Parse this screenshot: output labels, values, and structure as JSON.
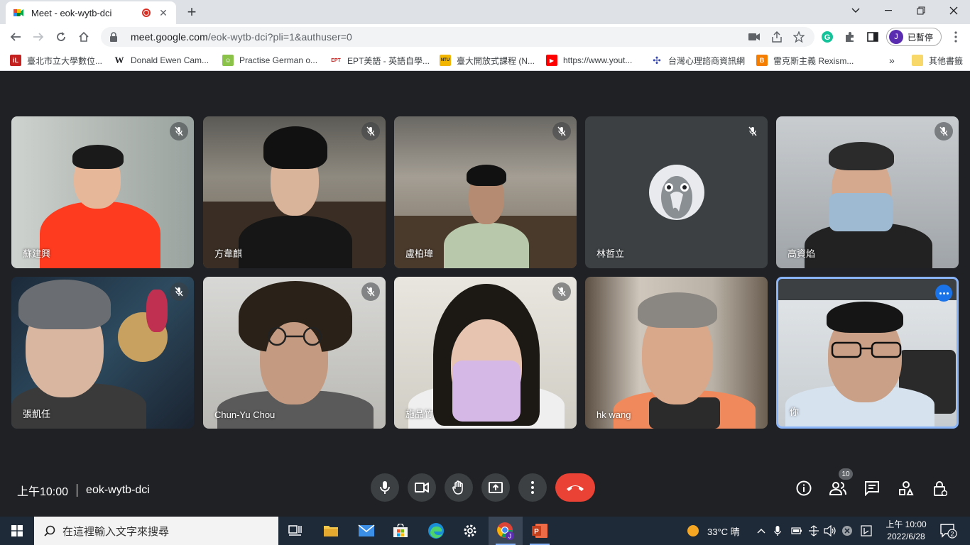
{
  "browser": {
    "tab_title": "Meet - eok-wytb-dci",
    "tab_close": "✕",
    "new_tab": "+",
    "url_host": "meet.google.com",
    "url_path": "/eok-wytb-dci?pli=1&authuser=0",
    "profile_initial": "J",
    "profile_label": "已暫停"
  },
  "bookmarks": [
    {
      "label": "臺北市立大學數位...",
      "icon": "iL",
      "color": "#c5221f"
    },
    {
      "label": "Donald Ewen Cam...",
      "icon": "W",
      "color": "#ffffff"
    },
    {
      "label": "Practise German o...",
      "icon": "☺",
      "color": "#8bc34a"
    },
    {
      "label": "EPT美語 - 英語自學...",
      "icon": "EPT",
      "color": "#ffffff"
    },
    {
      "label": "臺大開放式課程 (N...",
      "icon": "NTU",
      "color": "#f2b600"
    },
    {
      "label": "https://www.yout...",
      "icon": "▶",
      "color": "#ff0000"
    },
    {
      "label": "台灣心理諮商資訊網",
      "icon": "✣",
      "color": "#ffffff"
    },
    {
      "label": "雷克斯主義 Rexism...",
      "icon": "B",
      "color": "#f57d00"
    }
  ],
  "bookmarks_more": "»",
  "bookmarks_other": "其他書籤",
  "participants": [
    {
      "name": "蘇建興",
      "muted": true
    },
    {
      "name": "方韋麒",
      "muted": true
    },
    {
      "name": "盧柏瑋",
      "muted": true
    },
    {
      "name": "林哲立",
      "muted": true
    },
    {
      "name": "高資焰",
      "muted": true
    },
    {
      "name": "張凱任",
      "muted": true
    },
    {
      "name": "Chun-Yu Chou",
      "muted": true
    },
    {
      "name": "施品竹",
      "muted": true
    },
    {
      "name": "hk wang",
      "muted": false
    },
    {
      "name": "你",
      "muted": false
    }
  ],
  "meeting": {
    "time": "上午10:00",
    "code": "eok-wytb-dci",
    "participant_count": "10"
  },
  "taskbar": {
    "search_placeholder": "在這裡輸入文字來搜尋",
    "weather": "33°C 晴",
    "clock_time": "上午 10:00",
    "clock_date": "2022/6/28",
    "notification_count": "2",
    "chrome_user_badge": "J"
  },
  "colors": {
    "meet_bg": "#202124",
    "end_call": "#ea4335",
    "accent_blue": "#8ab4f8"
  }
}
